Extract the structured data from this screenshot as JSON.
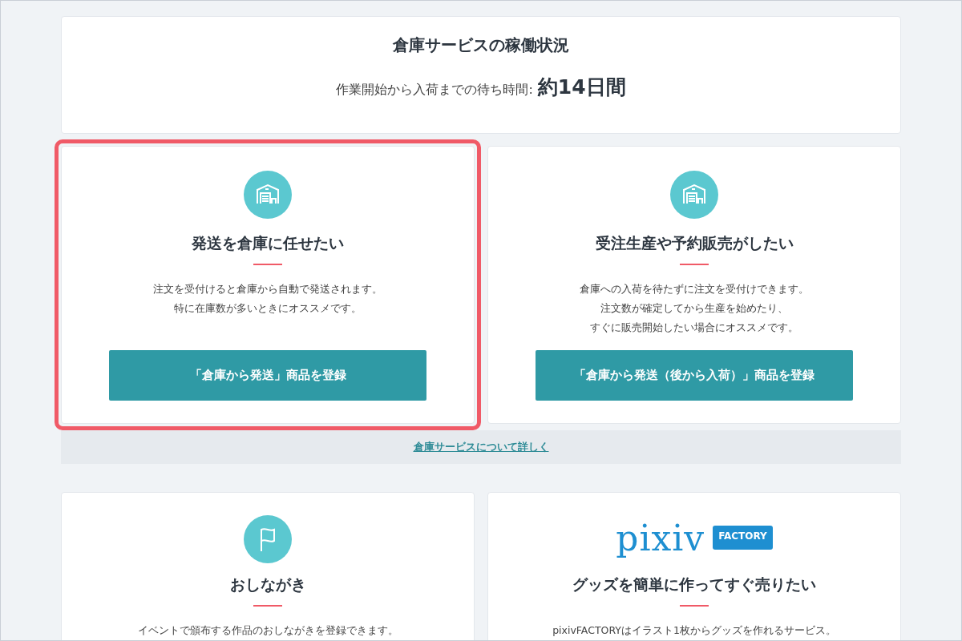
{
  "status": {
    "title": "倉庫サービスの稼働状況",
    "label": "作業開始から入荷までの待ち時間:",
    "value": "約14日間"
  },
  "services": [
    {
      "kind": "warehouse",
      "highlighted": true,
      "title": "発送を倉庫に任せたい",
      "description": [
        "注文を受付けると倉庫から自動で発送されます。",
        "特に在庫数が多いときにオススメです。"
      ],
      "button": "「倉庫から発送」商品を登録"
    },
    {
      "kind": "warehouse",
      "highlighted": false,
      "title": "受注生産や予約販売がしたい",
      "description": [
        "倉庫への入荷を待たずに注文を受付けできます。",
        "注文数が確定してから生産を始めたり、",
        "すぐに販売開始したい場合にオススメです。"
      ],
      "button": "「倉庫から発送（後から入荷）」商品を登録"
    }
  ],
  "more_link": "倉庫サービスについて詳しく",
  "features": [
    {
      "kind": "flag",
      "title": "おしながき",
      "description": [
        "イベントで頒布する作品のおしながきを登録できます。"
      ]
    },
    {
      "kind": "logo",
      "logo": {
        "word": "pixiv",
        "badge": "FACTORY"
      },
      "title": "グッズを簡単に作ってすぐ売りたい",
      "description": [
        "pixivFACTORYはイラスト1枚からグッズを作れるサービス。"
      ]
    }
  ]
}
